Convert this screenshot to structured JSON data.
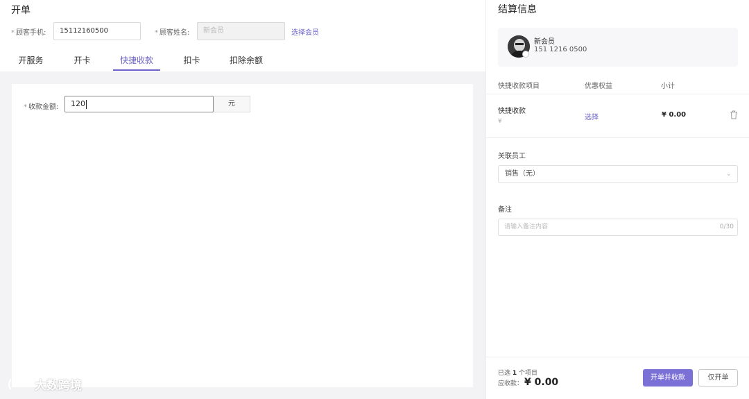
{
  "order": {
    "title": "开单",
    "phone_label": "顾客手机:",
    "phone_value": "15112160500",
    "name_label": "顾客姓名:",
    "name_placeholder": "新会员",
    "select_member_link": "选择会员",
    "required_mark": "*"
  },
  "tabs": [
    {
      "label": "开服务",
      "active": false
    },
    {
      "label": "开卡",
      "active": false
    },
    {
      "label": "快捷收款",
      "active": true
    },
    {
      "label": "扣卡",
      "active": false
    },
    {
      "label": "扣除余额",
      "active": false
    }
  ],
  "quick_pay": {
    "amount_label": "收款金额:",
    "amount_value": "120",
    "unit": "元"
  },
  "settlement": {
    "title": "结算信息",
    "member_name": "新会员",
    "member_phone": "151 1216 0500",
    "columns": [
      "快捷收款项目",
      "优惠权益",
      "小计"
    ],
    "item": {
      "name": "快捷收款",
      "sub": "¥",
      "discount_link": "选择",
      "subtotal": "¥ 0.00"
    },
    "staff_label": "关联员工",
    "staff_select": "销售（无）",
    "remark_label": "备注",
    "remark_placeholder": "请输入备注内容",
    "remark_count": "0/30",
    "selected_prefix": "已选",
    "selected_count": "1",
    "selected_suffix": "个项目",
    "due_label": "应收款：",
    "due_total": "¥ 0.00",
    "btn_open_and_collect": "开单并收款",
    "btn_open_only": "仅开单"
  },
  "watermark": "大数跨境",
  "colors": {
    "accent": "#6b63c8",
    "primary_button": "#7b70d6"
  }
}
